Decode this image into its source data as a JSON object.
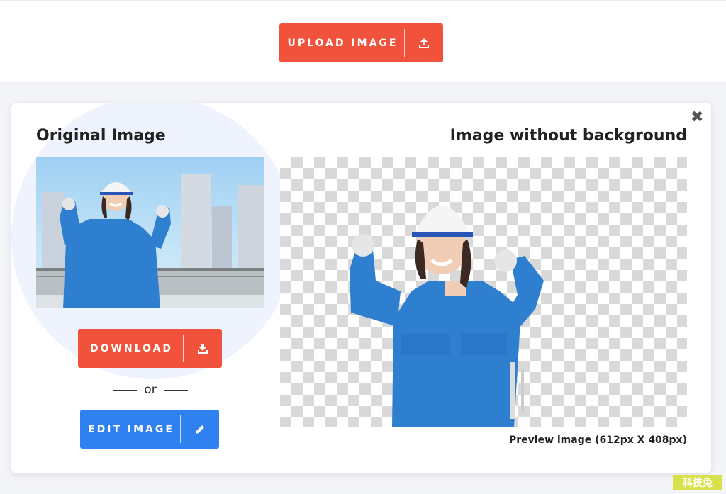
{
  "header": {
    "upload_label": "UPLOAD IMAGE",
    "upload_icon": "upload-icon"
  },
  "result": {
    "close_icon": "close-icon",
    "close_glyph": "✖",
    "original_title": "Original Image",
    "removed_title": "Image without background",
    "download_label": "DOWNLOAD",
    "download_icon": "download-icon",
    "or_text": "or",
    "edit_label": "EDIT IMAGE",
    "edit_icon": "pencil-icon",
    "preview_caption": "Preview image (612px X 408px)"
  },
  "watermark": {
    "text": "科技兔"
  },
  "colors": {
    "primary_red": "#f0523b",
    "primary_blue": "#2f80f0",
    "card_background": "#ffffff",
    "page_background": "#f3f4f8"
  }
}
